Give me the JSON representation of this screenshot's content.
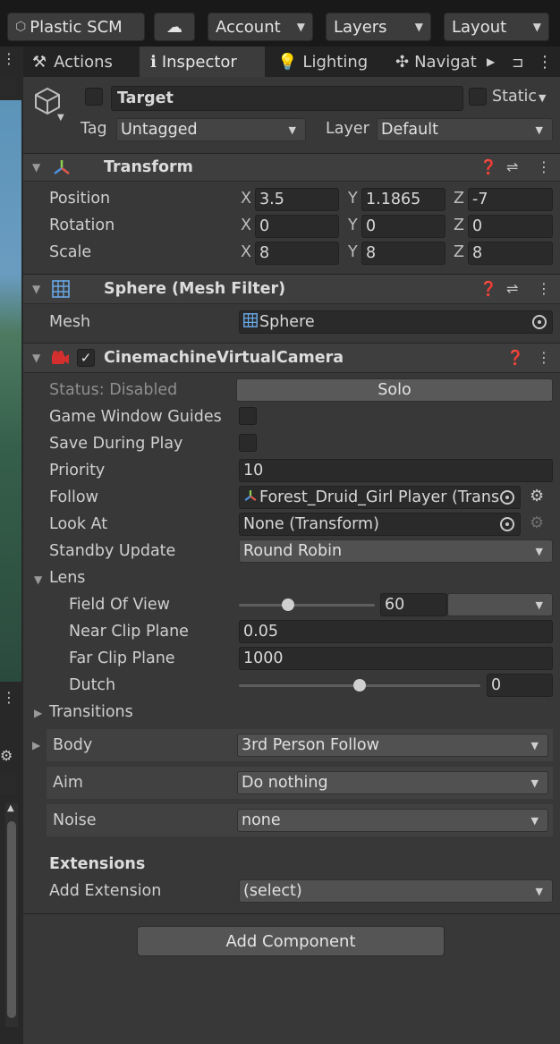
{
  "toolbar": {
    "plastic_label": "Plastic SCM",
    "account_label": "Account",
    "layers_label": "Layers",
    "layout_label": "Layout"
  },
  "tabs": [
    {
      "label": "Actions",
      "icon": "actions-icon"
    },
    {
      "label": "Inspector",
      "icon": "info-icon"
    },
    {
      "label": "Lighting",
      "icon": "bulb-icon"
    },
    {
      "label": "Navigat",
      "icon": "navigation-icon"
    }
  ],
  "object": {
    "name": "Target",
    "static_label": "Static",
    "tag_label": "Tag",
    "tag_value": "Untagged",
    "layer_label": "Layer",
    "layer_value": "Default"
  },
  "transform": {
    "title": "Transform",
    "rows": [
      {
        "label": "Position",
        "x": "3.5",
        "y": "1.1865",
        "z": "-7"
      },
      {
        "label": "Rotation",
        "x": "0",
        "y": "0",
        "z": "0"
      },
      {
        "label": "Scale",
        "x": "8",
        "y": "8",
        "z": "8"
      }
    ],
    "axis": {
      "x": "X",
      "y": "Y",
      "z": "Z"
    }
  },
  "mesh_filter": {
    "title": "Sphere (Mesh Filter)",
    "mesh_label": "Mesh",
    "mesh_value": "Sphere"
  },
  "vcam": {
    "title": "CinemachineVirtualCamera",
    "status_label": "Status: Disabled",
    "solo_label": "Solo",
    "game_window_guides_label": "Game Window Guides",
    "save_during_play_label": "Save During Play",
    "priority_label": "Priority",
    "priority_value": "10",
    "follow_label": "Follow",
    "follow_value": "Forest_Druid_Girl Player (Trans",
    "look_at_label": "Look At",
    "look_at_value": "None (Transform)",
    "standby_label": "Standby Update",
    "standby_value": "Round Robin",
    "lens_label": "Lens",
    "fov_label": "Field Of View",
    "fov_value": "60",
    "fov_fraction": 0.35,
    "near_label": "Near Clip Plane",
    "near_value": "0.05",
    "far_label": "Far Clip Plane",
    "far_value": "1000",
    "dutch_label": "Dutch",
    "dutch_value": "0",
    "dutch_fraction": 0.5,
    "transitions_label": "Transitions",
    "body_label": "Body",
    "body_value": "3rd Person Follow",
    "aim_label": "Aim",
    "aim_value": "Do nothing",
    "noise_label": "Noise",
    "noise_value": "none",
    "extensions_label": "Extensions",
    "add_extension_label": "Add Extension",
    "add_extension_value": "(select)"
  },
  "add_component_label": "Add Component",
  "colors": {
    "panel": "#383838",
    "header": "#3e3e3e",
    "field": "#2a2a2a",
    "dropdown": "#515151"
  }
}
